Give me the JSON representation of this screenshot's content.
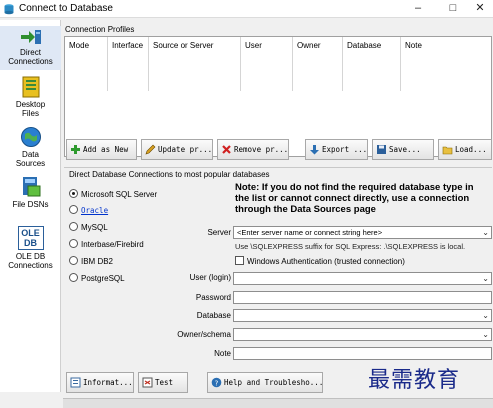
{
  "window": {
    "title": "Connect to Database"
  },
  "sidebar": {
    "items": [
      {
        "label1": "Direct",
        "label2": "Connections",
        "icon": "direct-connections-icon"
      },
      {
        "label1": "Desktop",
        "label2": "Files",
        "icon": "desktop-files-icon"
      },
      {
        "label1": "Data",
        "label2": "Sources",
        "icon": "data-sources-icon"
      },
      {
        "label1": "File DSNs",
        "label2": "",
        "icon": "file-dsns-icon"
      },
      {
        "label1": "OLE DB",
        "label2": "Connections",
        "icon": "ole-db-icon",
        "badge1": "OLE",
        "badge2": "DB"
      }
    ]
  },
  "profiles": {
    "section_label": "Connection Profiles",
    "columns": [
      "Mode",
      "Interface",
      "Source or Server",
      "User",
      "Owner",
      "Database",
      "Note"
    ]
  },
  "toolbar": {
    "add": "Add as New",
    "update": "Update pr...",
    "remove": "Remove pr...",
    "export": "Export ...",
    "save": "Save...",
    "load": "Load..."
  },
  "direct": {
    "section_label": "Direct Database Connections to most popular databases",
    "options": [
      "Microsoft SQL Server",
      "Oracle",
      "MySQL",
      "Interbase/Firebird",
      "IBM DB2",
      "PostgreSQL"
    ],
    "selected": "Microsoft SQL Server",
    "note": "Note: If you do not find the required database type in the list or cannot connect directly, use a connection through the Data Sources page",
    "server_label": "Server",
    "server_placeholder": "<Enter server name or connect string here>",
    "hint": "Use \\SQLEXPRESS suffix for SQL Express: .\\SQLEXPRESS is local.",
    "windows_auth": "Windows Authentication (trusted connection)",
    "user_label": "User (login)",
    "password_label": "Password",
    "database_label": "Database",
    "owner_label": "Owner/schema",
    "note_label": "Note"
  },
  "bottom": {
    "info": "Informat...",
    "test": "Test",
    "help": "Help and Troublesho..."
  },
  "watermark": "最需教育",
  "colors": {
    "link": "#0033cc",
    "watermark": "#1a2a8a",
    "active_sidebar": "#dfe8f5"
  }
}
